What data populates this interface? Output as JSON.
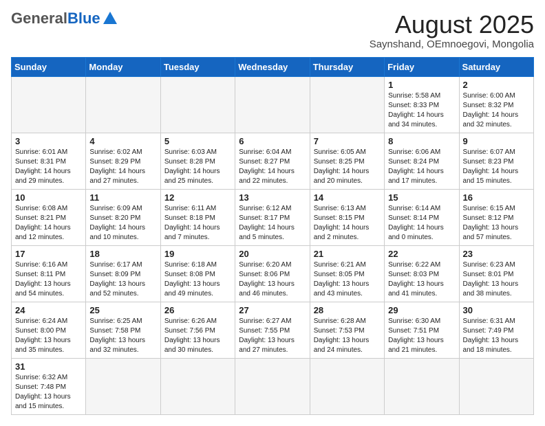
{
  "header": {
    "logo_general": "General",
    "logo_blue": "Blue",
    "title": "August 2025",
    "subtitle": "Saynshand, OEmnoegovi, Mongolia"
  },
  "weekdays": [
    "Sunday",
    "Monday",
    "Tuesday",
    "Wednesday",
    "Thursday",
    "Friday",
    "Saturday"
  ],
  "weeks": [
    [
      {
        "day": "",
        "info": ""
      },
      {
        "day": "",
        "info": ""
      },
      {
        "day": "",
        "info": ""
      },
      {
        "day": "",
        "info": ""
      },
      {
        "day": "",
        "info": ""
      },
      {
        "day": "1",
        "info": "Sunrise: 5:58 AM\nSunset: 8:33 PM\nDaylight: 14 hours and 34 minutes."
      },
      {
        "day": "2",
        "info": "Sunrise: 6:00 AM\nSunset: 8:32 PM\nDaylight: 14 hours and 32 minutes."
      }
    ],
    [
      {
        "day": "3",
        "info": "Sunrise: 6:01 AM\nSunset: 8:31 PM\nDaylight: 14 hours and 29 minutes."
      },
      {
        "day": "4",
        "info": "Sunrise: 6:02 AM\nSunset: 8:29 PM\nDaylight: 14 hours and 27 minutes."
      },
      {
        "day": "5",
        "info": "Sunrise: 6:03 AM\nSunset: 8:28 PM\nDaylight: 14 hours and 25 minutes."
      },
      {
        "day": "6",
        "info": "Sunrise: 6:04 AM\nSunset: 8:27 PM\nDaylight: 14 hours and 22 minutes."
      },
      {
        "day": "7",
        "info": "Sunrise: 6:05 AM\nSunset: 8:25 PM\nDaylight: 14 hours and 20 minutes."
      },
      {
        "day": "8",
        "info": "Sunrise: 6:06 AM\nSunset: 8:24 PM\nDaylight: 14 hours and 17 minutes."
      },
      {
        "day": "9",
        "info": "Sunrise: 6:07 AM\nSunset: 8:23 PM\nDaylight: 14 hours and 15 minutes."
      }
    ],
    [
      {
        "day": "10",
        "info": "Sunrise: 6:08 AM\nSunset: 8:21 PM\nDaylight: 14 hours and 12 minutes."
      },
      {
        "day": "11",
        "info": "Sunrise: 6:09 AM\nSunset: 8:20 PM\nDaylight: 14 hours and 10 minutes."
      },
      {
        "day": "12",
        "info": "Sunrise: 6:11 AM\nSunset: 8:18 PM\nDaylight: 14 hours and 7 minutes."
      },
      {
        "day": "13",
        "info": "Sunrise: 6:12 AM\nSunset: 8:17 PM\nDaylight: 14 hours and 5 minutes."
      },
      {
        "day": "14",
        "info": "Sunrise: 6:13 AM\nSunset: 8:15 PM\nDaylight: 14 hours and 2 minutes."
      },
      {
        "day": "15",
        "info": "Sunrise: 6:14 AM\nSunset: 8:14 PM\nDaylight: 14 hours and 0 minutes."
      },
      {
        "day": "16",
        "info": "Sunrise: 6:15 AM\nSunset: 8:12 PM\nDaylight: 13 hours and 57 minutes."
      }
    ],
    [
      {
        "day": "17",
        "info": "Sunrise: 6:16 AM\nSunset: 8:11 PM\nDaylight: 13 hours and 54 minutes."
      },
      {
        "day": "18",
        "info": "Sunrise: 6:17 AM\nSunset: 8:09 PM\nDaylight: 13 hours and 52 minutes."
      },
      {
        "day": "19",
        "info": "Sunrise: 6:18 AM\nSunset: 8:08 PM\nDaylight: 13 hours and 49 minutes."
      },
      {
        "day": "20",
        "info": "Sunrise: 6:20 AM\nSunset: 8:06 PM\nDaylight: 13 hours and 46 minutes."
      },
      {
        "day": "21",
        "info": "Sunrise: 6:21 AM\nSunset: 8:05 PM\nDaylight: 13 hours and 43 minutes."
      },
      {
        "day": "22",
        "info": "Sunrise: 6:22 AM\nSunset: 8:03 PM\nDaylight: 13 hours and 41 minutes."
      },
      {
        "day": "23",
        "info": "Sunrise: 6:23 AM\nSunset: 8:01 PM\nDaylight: 13 hours and 38 minutes."
      }
    ],
    [
      {
        "day": "24",
        "info": "Sunrise: 6:24 AM\nSunset: 8:00 PM\nDaylight: 13 hours and 35 minutes."
      },
      {
        "day": "25",
        "info": "Sunrise: 6:25 AM\nSunset: 7:58 PM\nDaylight: 13 hours and 32 minutes."
      },
      {
        "day": "26",
        "info": "Sunrise: 6:26 AM\nSunset: 7:56 PM\nDaylight: 13 hours and 30 minutes."
      },
      {
        "day": "27",
        "info": "Sunrise: 6:27 AM\nSunset: 7:55 PM\nDaylight: 13 hours and 27 minutes."
      },
      {
        "day": "28",
        "info": "Sunrise: 6:28 AM\nSunset: 7:53 PM\nDaylight: 13 hours and 24 minutes."
      },
      {
        "day": "29",
        "info": "Sunrise: 6:30 AM\nSunset: 7:51 PM\nDaylight: 13 hours and 21 minutes."
      },
      {
        "day": "30",
        "info": "Sunrise: 6:31 AM\nSunset: 7:49 PM\nDaylight: 13 hours and 18 minutes."
      }
    ],
    [
      {
        "day": "31",
        "info": "Sunrise: 6:32 AM\nSunset: 7:48 PM\nDaylight: 13 hours and 15 minutes."
      },
      {
        "day": "",
        "info": ""
      },
      {
        "day": "",
        "info": ""
      },
      {
        "day": "",
        "info": ""
      },
      {
        "day": "",
        "info": ""
      },
      {
        "day": "",
        "info": ""
      },
      {
        "day": "",
        "info": ""
      }
    ]
  ]
}
